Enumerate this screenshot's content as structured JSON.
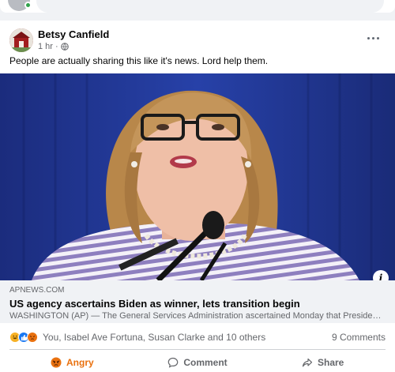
{
  "post": {
    "author": "Betsy Canfield",
    "time": "1 hr",
    "separator": "·",
    "text": "People are actually sharing this like it's news. Lord help them.",
    "link": {
      "domain": "APNEWS.COM",
      "title": "US agency ascertains Biden as winner, lets transition begin",
      "description": "WASHINGTON (AP) — The General Services Administration ascertained Monday that President..."
    },
    "info_label": "i",
    "reactions": {
      "icons": [
        "haha-icon",
        "like-icon",
        "angry-icon"
      ],
      "text": "You, Isabel Ave Fortuna, Susan Clarke and 10 others",
      "comments": "9 Comments"
    },
    "actions": {
      "react_label": "Angry",
      "comment_label": "Comment",
      "share_label": "Share"
    }
  },
  "colors": {
    "angry": "#e9710f",
    "like": "#1877f2",
    "haha": "#f7b125",
    "online": "#31a24c",
    "secondary_text": "#65676b"
  }
}
